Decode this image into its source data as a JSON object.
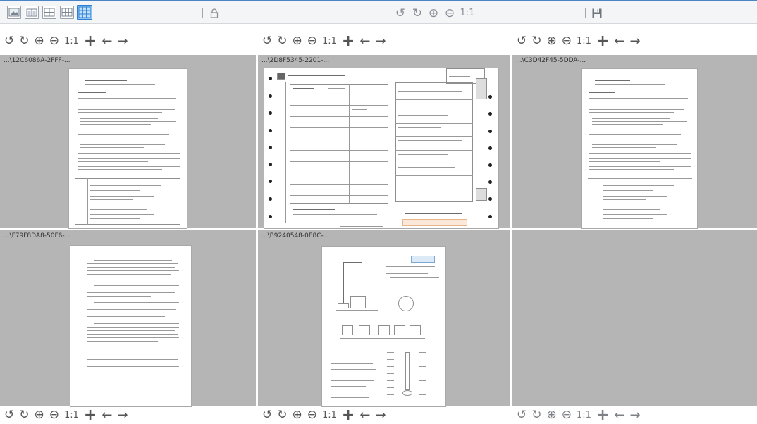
{
  "toolbar": {
    "layout_buttons": [
      {
        "name": "single",
        "icon": "single-view-icon"
      },
      {
        "name": "two",
        "icon": "two-view-icon"
      },
      {
        "name": "four",
        "icon": "grid-4-icon"
      },
      {
        "name": "six",
        "icon": "grid-6-icon"
      },
      {
        "name": "nine",
        "icon": "grid-9-icon",
        "active": true
      }
    ],
    "lock_icon": "lock-icon",
    "rotate_left_icon": "rotate-left-icon",
    "rotate_right_icon": "rotate-right-icon",
    "zoom_in_icon": "zoom-in-icon",
    "zoom_out_icon": "zoom-out-icon",
    "actual_size": "1:1",
    "save_icon": "save-icon",
    "accent": "#4a86c5"
  },
  "controls": {
    "rotate_left": "↺",
    "rotate_right": "↻",
    "zoom_in": "⊕",
    "zoom_out": "⊖",
    "actual_size": "1:1",
    "add": "+",
    "prev": "←",
    "next": "→"
  },
  "panes": [
    {
      "label": "...\\12C6086A-2FFF-...",
      "page_type": "text"
    },
    {
      "label": "...\\2D8F5345-2201-...",
      "page_type": "form"
    },
    {
      "label": "...\\C3D42F45-5DDA-...",
      "page_type": "text"
    },
    {
      "label": "...\\F79F8DA8-50F6-...",
      "page_type": "letter"
    },
    {
      "label": "...\\B9240548-0E8C-...",
      "page_type": "drawing"
    },
    {
      "label": "",
      "page_type": "empty"
    }
  ]
}
